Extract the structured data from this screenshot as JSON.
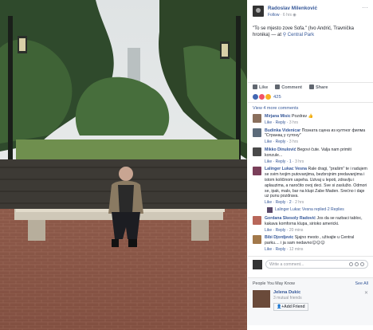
{
  "post": {
    "author": "Radoslav Milenković",
    "follow": "Follow",
    "time": "6 hrs",
    "caption": "\"To se mjesto zove Sofa.\" (Ivo Andrić, Travnička hronika) — at",
    "location": "Central Park",
    "reaction_count": "425"
  },
  "actions": {
    "like": "Like",
    "comment": "Comment",
    "share": "Share"
  },
  "comments": {
    "view_more": "View 4 more comments",
    "items": [
      {
        "name": "Mirjana Misic",
        "text": "Pozdrav 👍",
        "like": "Like",
        "reply": "Reply",
        "time": "3 hrs",
        "avatar_color": "#8a6f5c"
      },
      {
        "name": "Budinka Videnicar",
        "text": "Познатa сцена из култног филма \"Странац у сутону\"",
        "like": "Like",
        "reply": "Reply",
        "time": "3 hrs",
        "avatar_color": "#5c6b7a"
      },
      {
        "name": "Mikko Dinulović",
        "text": "Begovi čute. Valja nam primiti konzule...",
        "like": "Like",
        "reply": "Reply",
        "time": "3 hrs",
        "count": "1",
        "avatar_color": "#4a4a4a"
      },
      {
        "name": "Lalinger Lukac Vesna",
        "text": "Rale dragi, \"prašim\" te i radujem se svim tvojim putovanjima, bezbrojnim predavanjima i istom količinom uspeha. Uzivaj u lepoti, zdravlju i aplauzima, a naročito ovoj deci. Sve si zaslužio. Odmori se, ipak, malo, bar na klupi Zabe Maden. Srećno i daje uz punu pozdrava.",
        "like": "Like",
        "reply": "Reply",
        "time": "2 hrs",
        "count": "2",
        "avatar_color": "#7a3f5a"
      }
    ],
    "reply_line": {
      "name": "Lalinger Lukac Vesna replied",
      "count": "2 Replies"
    },
    "items2": [
      {
        "name": "Gordana Skesoly Radović",
        "text": "Jos da se razbaci tabloc, kakava komforna klupa, sirioko americki.",
        "like": "Like",
        "reply": "Reply",
        "time": "20 mins",
        "avatar_color": "#b8675a"
      },
      {
        "name": "Bibi Djordjevic",
        "text": "Sjajno mesto , uživajte u Central parku.... i ja sam nedavno😊😊😊",
        "like": "Like",
        "reply": "Reply",
        "time": "12 mins",
        "avatar_color": "#a2784a"
      }
    ],
    "write_placeholder": "Write a comment..."
  },
  "pymk": {
    "title": "People You May Know",
    "see_all": "See All",
    "name": "Jelena Dukic",
    "mutual": "3 mutual friends",
    "add": "Add Friend"
  }
}
